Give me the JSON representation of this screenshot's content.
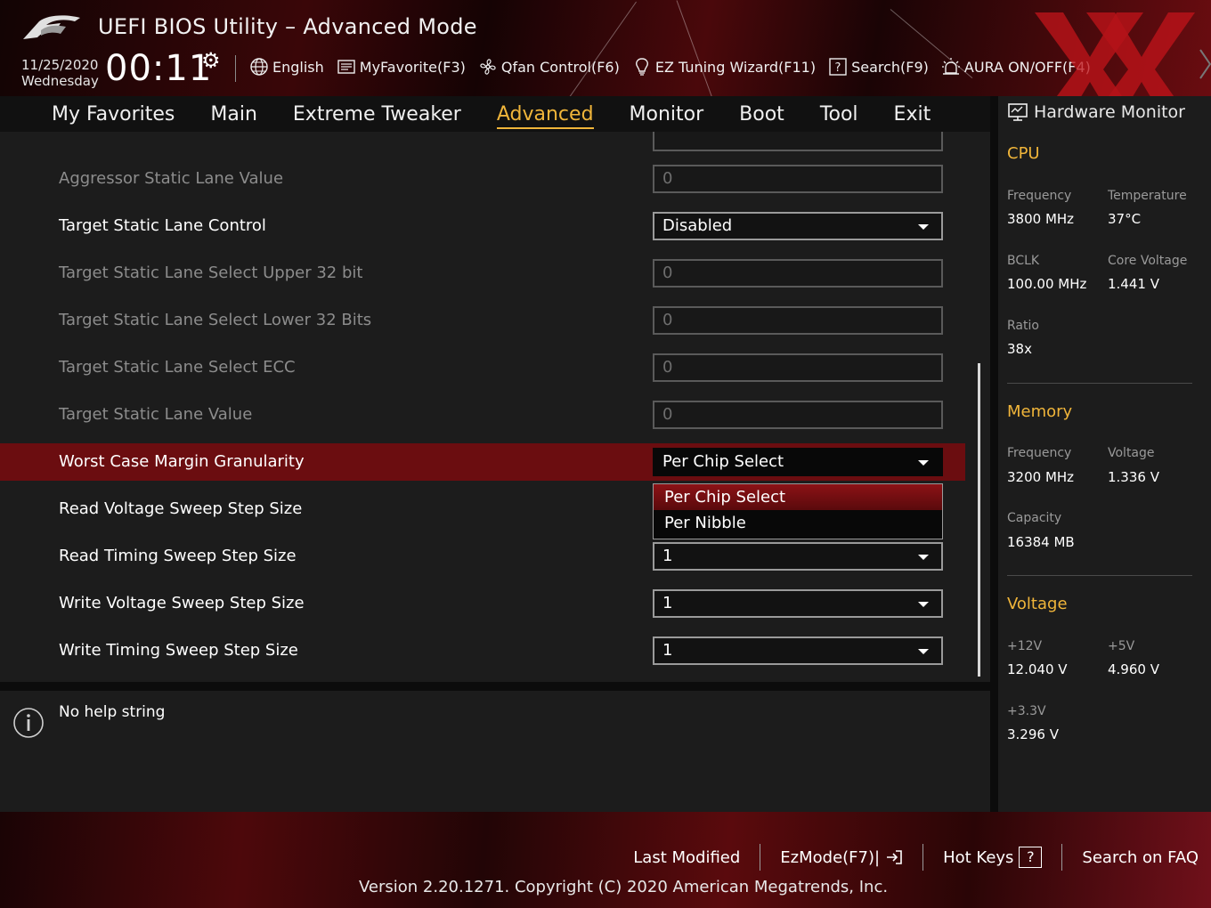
{
  "header": {
    "title": "UEFI BIOS Utility – Advanced Mode",
    "date": "11/25/2020",
    "weekday": "Wednesday",
    "time": "00:11",
    "toolbar": [
      {
        "label": "English",
        "icon": "globe-icon"
      },
      {
        "label": "MyFavorite(F3)",
        "icon": "favorite-list-icon"
      },
      {
        "label": "Qfan Control(F6)",
        "icon": "fan-icon"
      },
      {
        "label": "EZ Tuning Wizard(F11)",
        "icon": "lightbulb-icon"
      },
      {
        "label": "Search(F9)",
        "icon": "help-box-icon"
      },
      {
        "label": "AURA ON/OFF(F4)",
        "icon": "aura-light-icon"
      }
    ]
  },
  "nav": {
    "tabs": [
      "My Favorites",
      "Main",
      "Extreme Tweaker",
      "Advanced",
      "Monitor",
      "Boot",
      "Tool",
      "Exit"
    ],
    "active": "Advanced"
  },
  "settings": [
    {
      "label": "Aggressor Static Lane Value",
      "value": "0",
      "type": "text",
      "disabled": true
    },
    {
      "label": "Target Static Lane Control",
      "value": "Disabled",
      "type": "dropdown",
      "disabled": false
    },
    {
      "label": "Target Static Lane Select Upper 32 bit",
      "value": "0",
      "type": "text",
      "disabled": true
    },
    {
      "label": "Target Static Lane Select Lower 32 Bits",
      "value": "0",
      "type": "text",
      "disabled": true
    },
    {
      "label": "Target Static Lane Select ECC",
      "value": "0",
      "type": "text",
      "disabled": true
    },
    {
      "label": "Target Static Lane Value",
      "value": "0",
      "type": "text",
      "disabled": true
    },
    {
      "label": "Worst Case Margin Granularity",
      "value": "Per Chip Select",
      "type": "dropdown",
      "disabled": false,
      "selected": true
    },
    {
      "label": "Read Voltage Sweep Step Size",
      "value": "",
      "type": "dropdown",
      "disabled": false
    },
    {
      "label": "Read Timing Sweep Step Size",
      "value": "1",
      "type": "dropdown",
      "disabled": false
    },
    {
      "label": "Write Voltage Sweep Step Size",
      "value": "1",
      "type": "dropdown",
      "disabled": false
    },
    {
      "label": "Write Timing Sweep Step Size",
      "value": "1",
      "type": "dropdown",
      "disabled": false
    }
  ],
  "dropdown_open": {
    "options": [
      "Per Chip Select",
      "Per Nibble"
    ],
    "highlighted": "Per Chip Select"
  },
  "help": {
    "text": "No help string"
  },
  "hardware_monitor": {
    "title": "Hardware Monitor",
    "cpu": {
      "title": "CPU",
      "frequency_label": "Frequency",
      "frequency": "3800 MHz",
      "temperature_label": "Temperature",
      "temperature": "37°C",
      "bclk_label": "BCLK",
      "bclk": "100.00 MHz",
      "core_voltage_label": "Core Voltage",
      "core_voltage": "1.441 V",
      "ratio_label": "Ratio",
      "ratio": "38x"
    },
    "memory": {
      "title": "Memory",
      "frequency_label": "Frequency",
      "frequency": "3200 MHz",
      "voltage_label": "Voltage",
      "voltage": "1.336 V",
      "capacity_label": "Capacity",
      "capacity": "16384 MB"
    },
    "voltage": {
      "title": "Voltage",
      "v12_label": "+12V",
      "v12": "12.040 V",
      "v5_label": "+5V",
      "v5": "4.960 V",
      "v33_label": "+3.3V",
      "v33": "3.296 V"
    }
  },
  "footer": {
    "last_modified": "Last Modified",
    "ezmode": "EzMode(F7)|",
    "hot_keys": "Hot Keys",
    "hot_keys_key": "?",
    "search_faq": "Search on FAQ",
    "version": "Version 2.20.1271. Copyright (C) 2020 American Megatrends, Inc."
  },
  "colors": {
    "accent": "#f0b53a",
    "selected_row": "#6b0d10",
    "brand_red": "#b0141a"
  }
}
